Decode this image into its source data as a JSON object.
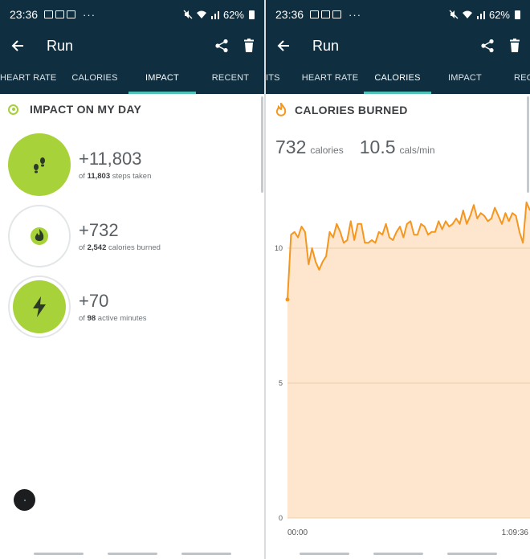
{
  "status": {
    "time": "23:36",
    "battery": "62%",
    "overflow": "···"
  },
  "app": {
    "title": "Run"
  },
  "left": {
    "tabs": [
      "HEART RATE",
      "CALORIES",
      "IMPACT",
      "RECENT"
    ],
    "active_tab": "IMPACT",
    "section_title": "IMPACT ON MY DAY",
    "impacts": [
      {
        "icon": "footsteps-icon",
        "value": "+11,803",
        "of": "of",
        "total": "11,803",
        "suffix": "steps taken",
        "progress": 1.0
      },
      {
        "icon": "flame-icon",
        "value": "+732",
        "of": "of",
        "total": "2,542",
        "suffix": "calories burned",
        "progress": 0.29
      },
      {
        "icon": "bolt-icon",
        "value": "+70",
        "of": "of",
        "total": "98",
        "suffix": "active minutes",
        "progress": 0.71
      }
    ]
  },
  "right": {
    "tabs": [
      "ITS",
      "HEART RATE",
      "CALORIES",
      "IMPACT",
      "REC"
    ],
    "active_tab": "CALORIES",
    "section_title": "CALORIES BURNED",
    "total_calories": "732",
    "total_calories_unit": "calories",
    "rate": "10.5",
    "rate_unit": "cals/min"
  },
  "colors": {
    "header": "#0f2e3f",
    "tab_indicator": "#4fc3b8",
    "impact_green": "#a8d23a",
    "line_orange": "#f5961e",
    "area_fill": "#fde6cd"
  },
  "chart_data": {
    "type": "area",
    "title": "CALORIES BURNED",
    "xlabel": "",
    "ylabel": "",
    "x_tick_labels": [
      "00:00",
      "1:09:36"
    ],
    "y_ticks": [
      0,
      5,
      10
    ],
    "ylim": [
      0,
      12.5
    ],
    "x_minutes": [
      0,
      1,
      2,
      3,
      4,
      5,
      6,
      7,
      8,
      9,
      10,
      11,
      12,
      13,
      14,
      15,
      16,
      17,
      18,
      19,
      20,
      21,
      22,
      23,
      24,
      25,
      26,
      27,
      28,
      29,
      30,
      31,
      32,
      33,
      34,
      35,
      36,
      37,
      38,
      39,
      40,
      41,
      42,
      43,
      44,
      45,
      46,
      47,
      48,
      49,
      50,
      51,
      52,
      53,
      54,
      55,
      56,
      57,
      58,
      59,
      60,
      61,
      62,
      63,
      64,
      65,
      66,
      67,
      68,
      69
    ],
    "values": [
      8.1,
      10.5,
      10.6,
      10.4,
      10.8,
      10.6,
      9.4,
      10.0,
      9.5,
      9.2,
      9.5,
      9.7,
      10.6,
      10.4,
      10.9,
      10.6,
      10.2,
      10.3,
      11.0,
      10.3,
      10.9,
      10.9,
      10.2,
      10.2,
      10.3,
      10.2,
      10.6,
      10.5,
      10.9,
      10.4,
      10.3,
      10.6,
      10.8,
      10.4,
      10.9,
      11.0,
      10.5,
      10.5,
      10.9,
      10.8,
      10.5,
      10.6,
      10.6,
      11.0,
      10.7,
      11.0,
      10.8,
      10.9,
      11.1,
      10.9,
      11.4,
      10.9,
      11.2,
      11.6,
      11.1,
      11.3,
      11.2,
      11.0,
      11.1,
      11.5,
      11.2,
      10.9,
      11.3,
      11.0,
      11.3,
      11.2,
      10.6,
      10.2,
      11.7,
      11.4
    ]
  }
}
